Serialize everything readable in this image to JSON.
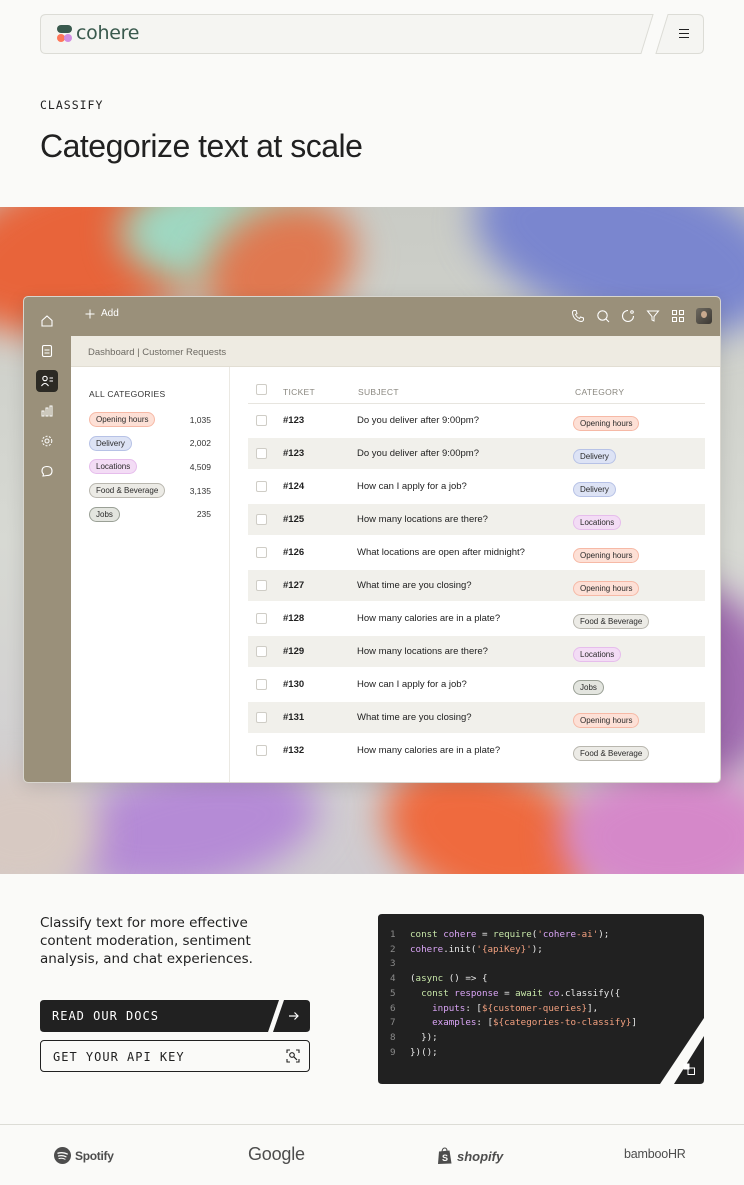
{
  "nav": {
    "logo_text": "cohere",
    "menu_icon": "hamburger-icon"
  },
  "hero": {
    "eyebrow": "CLASSIFY",
    "headline": "Categorize text at scale"
  },
  "app": {
    "add_label": "Add",
    "breadcrumb": "Dashboard | Customer Requests",
    "categories_title": "ALL CATEGORIES",
    "categories": [
      {
        "label": "Opening hours",
        "count": "1,035",
        "style": "hours"
      },
      {
        "label": "Delivery",
        "count": "2,002",
        "style": "delivery"
      },
      {
        "label": "Locations",
        "count": "4,509",
        "style": "locations"
      },
      {
        "label": "Food & Beverage",
        "count": "3,135",
        "style": "food"
      },
      {
        "label": "Jobs",
        "count": "235",
        "style": "jobs"
      }
    ],
    "columns": {
      "ticket": "TICKET",
      "subject": "SUBJECT",
      "category": "CATEGORY"
    },
    "rows": [
      {
        "ticket": "#123",
        "subject": "Do you deliver after 9:00pm?",
        "category": "Opening hours",
        "style": "hours"
      },
      {
        "ticket": "#123",
        "subject": "Do you deliver after 9:00pm?",
        "category": "Delivery",
        "style": "delivery"
      },
      {
        "ticket": "#124",
        "subject": "How can I apply for a job?",
        "category": "Delivery",
        "style": "delivery"
      },
      {
        "ticket": "#125",
        "subject": "How many locations are there?",
        "category": "Locations",
        "style": "locations"
      },
      {
        "ticket": "#126",
        "subject": "What locations are open after midnight?",
        "category": "Opening hours",
        "style": "hours"
      },
      {
        "ticket": "#127",
        "subject": "What time are you closing?",
        "category": "Opening hours",
        "style": "hours"
      },
      {
        "ticket": "#128",
        "subject": "How many calories are in a plate?",
        "category": "Food & Beverage",
        "style": "food"
      },
      {
        "ticket": "#129",
        "subject": "How many locations are there?",
        "category": "Locations",
        "style": "locations"
      },
      {
        "ticket": "#130",
        "subject": "How can I apply for a job?",
        "category": "Jobs",
        "style": "jobs"
      },
      {
        "ticket": "#131",
        "subject": "What time are you closing?",
        "category": "Opening hours",
        "style": "hours"
      },
      {
        "ticket": "#132",
        "subject": "How many calories are in a plate?",
        "category": "Food & Beverage",
        "style": "food"
      }
    ]
  },
  "section": {
    "description": "Classify text for more effective content moderation, sentiment analysis, and chat experiences.",
    "docs_button": "READ OUR DOCS",
    "api_button": "GET YOUR API KEY"
  },
  "code": {
    "lines": [
      "const cohere = require('cohere-ai');",
      "cohere.init('{apiKey}');",
      "",
      "(async () => {",
      "  const response = await co.classify({",
      "    inputs: [${customer-queries}],",
      "    examples: [${categories-to-classify}]",
      "  });",
      "})();"
    ]
  },
  "logos": [
    "Spotify",
    "Google",
    "shopify",
    "bambooHR"
  ],
  "colors": {
    "ink": "#212121",
    "brand_green": "#39594d",
    "coral": "#ff7759",
    "lavender": "#d18ee2",
    "rail": "#9a907a"
  }
}
